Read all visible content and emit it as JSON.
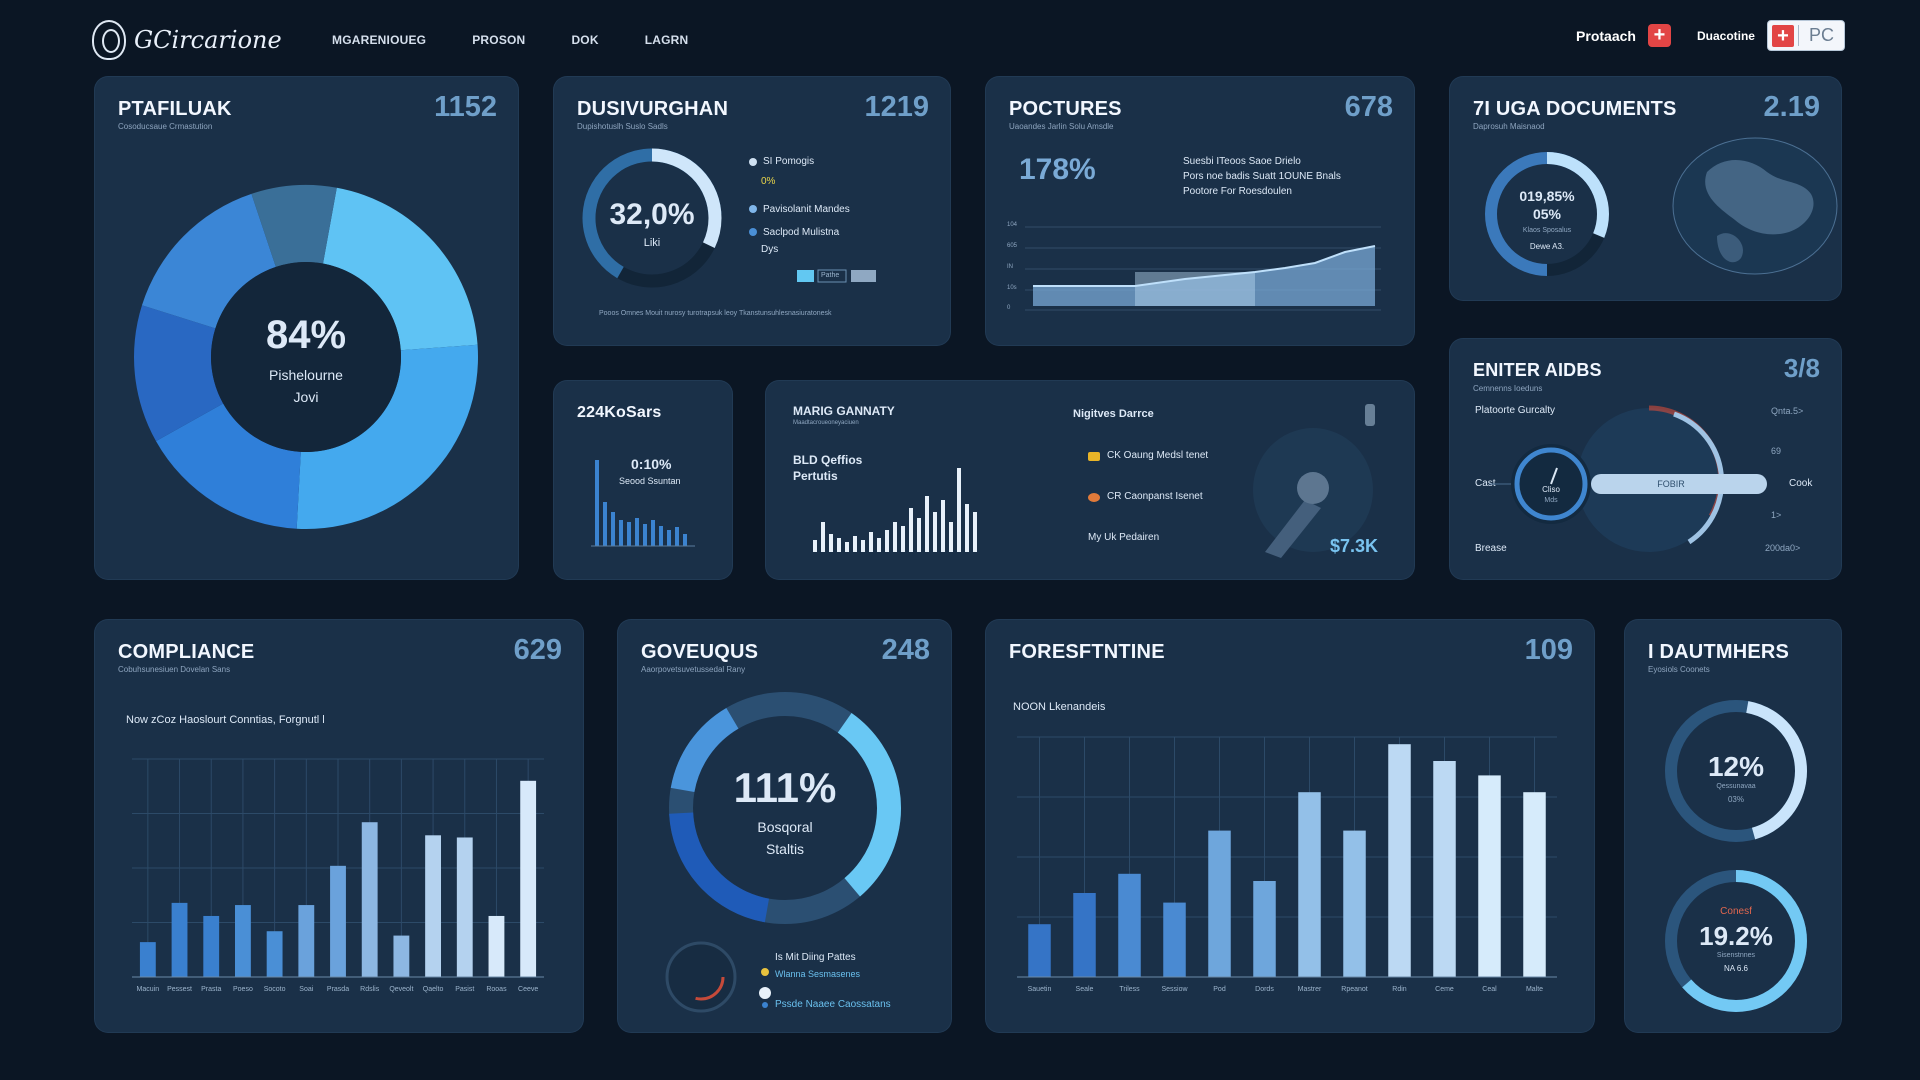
{
  "header": {
    "logo_text": "GCircarione",
    "nav": [
      "MGARENIOUEG",
      "PROSON",
      "DOK",
      "LAGRN"
    ],
    "right_label": "Protaach",
    "right_label2": "Duacotine",
    "pc_label": "PC"
  },
  "colors": {
    "background": "#0b1624",
    "card": "#1a3048",
    "accent": "#36b8f0",
    "blue_dark": "#1f5fbd",
    "blue_mid": "#3978cf",
    "blue_light": "#5eb7ef",
    "muted": "#6f9fc9"
  },
  "cards": {
    "ptafiluak": {
      "title": "PTAFILUAK",
      "number": "1152",
      "subtitle": "Cosoducsaue Crmastution",
      "center_percent": "84%",
      "center_line1": "Pishelourne",
      "center_line2": "Jovi"
    },
    "dusivurghan": {
      "title": "DUSIVURGHAN",
      "number": "1219",
      "subtitle": "Dupishotuslh Suslo Sadls",
      "center_percent": "32,0%",
      "center_sub": "Liki",
      "legend": [
        "SI Pomogis",
        "0%",
        "Pavisolanit Mandes",
        "Saclpod Mulistna",
        "Dys"
      ],
      "legend_mini": "Pathe",
      "footer": "Pooos Omnes Mouit nurosy turotrapsuk leoy Tkanstunsuhlesnasiuratonesk"
    },
    "poctures": {
      "title": "POCTURES",
      "number": "678",
      "subtitle": "Uaoandes Jarlin Solu Amsdle",
      "big_percent": "178%",
      "desc1": "Suesbi ITeoos Saoe Drielo",
      "desc2": "Pors noe badis Suatt 1OUNE Bnals",
      "desc3": "Pootore For Roesdoulen",
      "ticks": [
        "104",
        "605",
        "IN",
        "10s",
        "0"
      ]
    },
    "documents": {
      "title": "7I UGA DOCUMENTS",
      "number": "2.19",
      "subtitle": "Daprosuh Maisnaod",
      "ring_line1": "019,85%",
      "ring_line2": "05%",
      "ring_line3": "Klaos Sposalus",
      "ring_line4": "Dewe A3."
    },
    "kosars": {
      "title": "224KoSars",
      "value": "0:10%",
      "value_sub": "Seood Ssuntan"
    },
    "marig": {
      "title": "MARIG GANNATY",
      "subtitle": "Maadtacroueoneyaciuen",
      "left_label1": "BLD Qeffios",
      "left_label2": "Pertutis",
      "right_title": "Nigitves Darrce",
      "item1": "CK Oaung Medsl tenet",
      "item2": "CR Caonpanst Isenet",
      "item3": "My Uk Pedairen",
      "amount": "$7.3K"
    },
    "enter_aidbs": {
      "title": "ENITER AIDBS",
      "number": "3/8",
      "subtitle": "Cemnenns Ioeduns",
      "label_top": "Platoorte Gurcalty",
      "right_top": "Qnta.5>",
      "left_cost": "Cast",
      "right_cost": "Cook",
      "bar_label": "FOBIR",
      "dial_text": "Cliso",
      "dial_sub": "Mds",
      "bottom_left": "Brease",
      "bottom_right": "200da0>",
      "mini_right1": "69",
      "mini_right2": "1>"
    },
    "compliance": {
      "title": "COMPLIANCE",
      "number": "629",
      "subtitle": "Cobuhsunesiuen Dovelan Sans",
      "caption": "Now zCoz Haoslourt Conntias, Forgnutl l"
    },
    "goveuqus": {
      "title": "GOVEUQUS",
      "number": "248",
      "subtitle": "Aaorpovetsuvetussedal Rany",
      "center_percent": "111%",
      "center_line1": "Bosqoral",
      "center_line2": "Staltis",
      "legend1": "Is Mit Diing Pattes",
      "legend2": "Wlanna Sesmasenes",
      "legend3": "Pssde Naaee Caossatans"
    },
    "foresftntine": {
      "title": "FORESFTNTINE",
      "number": "109",
      "caption": "NOON Lkenandeis"
    },
    "dautmhers": {
      "title": "I DAUTMHERS",
      "subtitle": "Eyosiols Coonets",
      "ring1_percent": "12%",
      "ring1_sub": "Qessunavaa",
      "ring1_sub2": "03%",
      "ring2_top": "Conesf",
      "ring2_percent": "19.2%",
      "ring2_sub": "Sisenstnnes",
      "ring2_sub2": "NA 6.6"
    }
  },
  "chart_data": [
    {
      "type": "pie",
      "title": "PTAFILUAK",
      "values": [
        84
      ]
    },
    {
      "type": "bar",
      "title": "COMPLIANCE",
      "categories": [
        "Macuin",
        "Pessest",
        "Prasta",
        "Poeso",
        "Socoto",
        "Soai",
        "Prasda",
        "Rdslis",
        "Qeveolt",
        "Qaelto",
        "Pasist",
        "Rooas",
        "Ceeve"
      ],
      "values": [
        16,
        34,
        28,
        33,
        21,
        33,
        51,
        71,
        19,
        65,
        64,
        28,
        90
      ],
      "ylim": [
        0,
        100
      ]
    },
    {
      "type": "bar",
      "title": "FORESFTNTINE",
      "categories": [
        "Sauetin",
        "Seale",
        "Triless",
        "Sessiow",
        "Pod",
        "Dords",
        "Mastrer",
        "Rpeanot",
        "Rdin",
        "Ceme",
        "Ceal",
        "Malte"
      ],
      "values": [
        22,
        35,
        43,
        31,
        61,
        40,
        77,
        61,
        97,
        90,
        84,
        77
      ],
      "ylim": [
        0,
        100
      ]
    }
  ]
}
